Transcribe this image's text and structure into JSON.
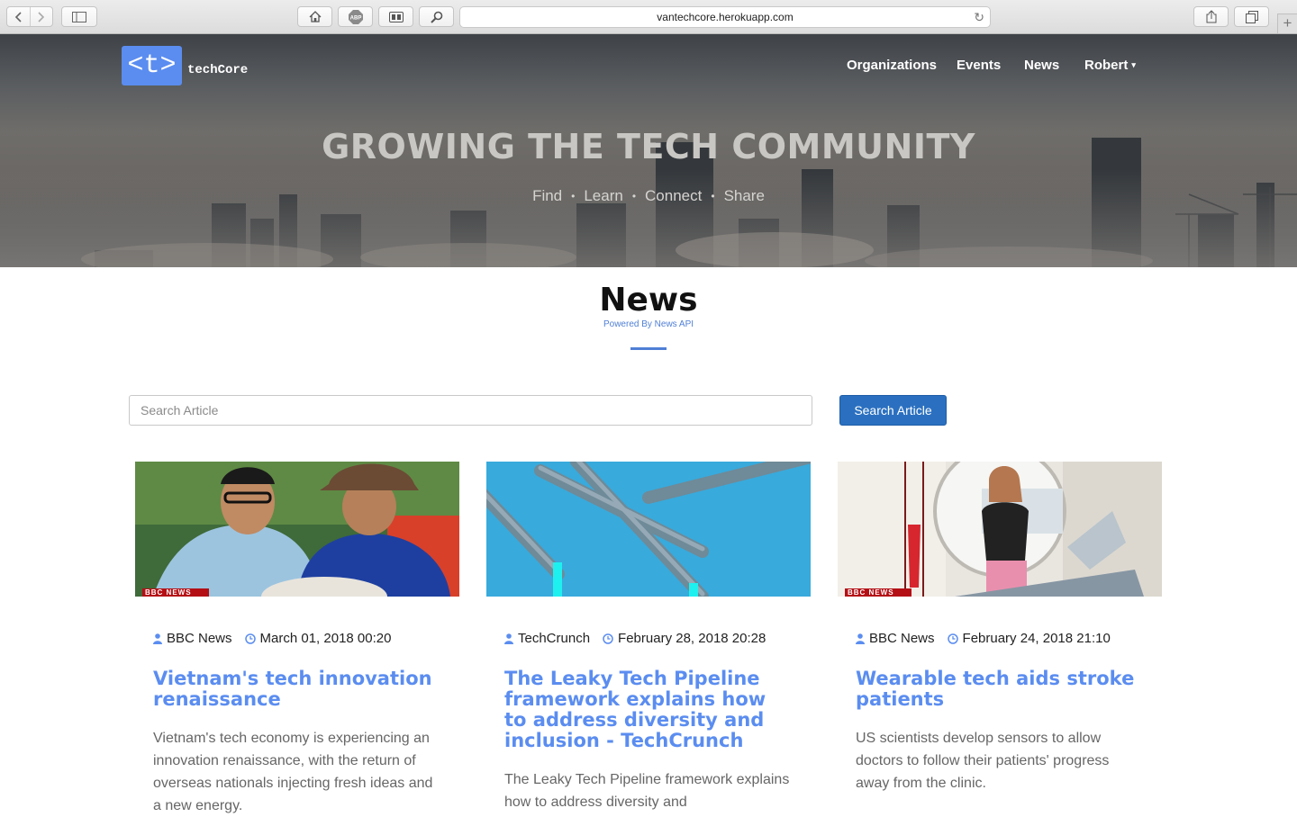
{
  "browser": {
    "url": "vantechcore.herokuapp.com"
  },
  "site": {
    "logo_mark": "<t>",
    "logo_text": "techCore",
    "nav": {
      "organizations": "Organizations",
      "events": "Events",
      "news": "News",
      "user": "Robert"
    },
    "hero": {
      "title": "GROWING THE TECH COMMUNITY",
      "tagline": [
        "Find",
        "Learn",
        "Connect",
        "Share"
      ]
    }
  },
  "news": {
    "heading": "News",
    "powered_by": "Powered By News API",
    "search_placeholder": "Search Article",
    "search_button": "Search Article",
    "articles": [
      {
        "source": "BBC News",
        "date": "March 01, 2018 00:20",
        "title": "Vietnam's tech innovation renaissance",
        "description": "Vietnam's tech economy is experiencing an innovation renaissance, with the return of overseas nationals injecting fresh ideas and a new energy."
      },
      {
        "source": "TechCrunch",
        "date": "February 28, 2018 20:28",
        "title": "The Leaky Tech Pipeline framework explains how to address diversity and inclusion - TechCrunch",
        "description": "The Leaky Tech Pipeline framework explains how to address diversity and"
      },
      {
        "source": "BBC News",
        "date": "February 24, 2018 21:10",
        "title": "Wearable tech aids stroke patients",
        "description": "US scientists develop sensors to allow doctors to follow their patients' progress away from the clinic."
      }
    ]
  },
  "colors": {
    "accent": "#5b8df0",
    "button": "#2b70c0"
  }
}
